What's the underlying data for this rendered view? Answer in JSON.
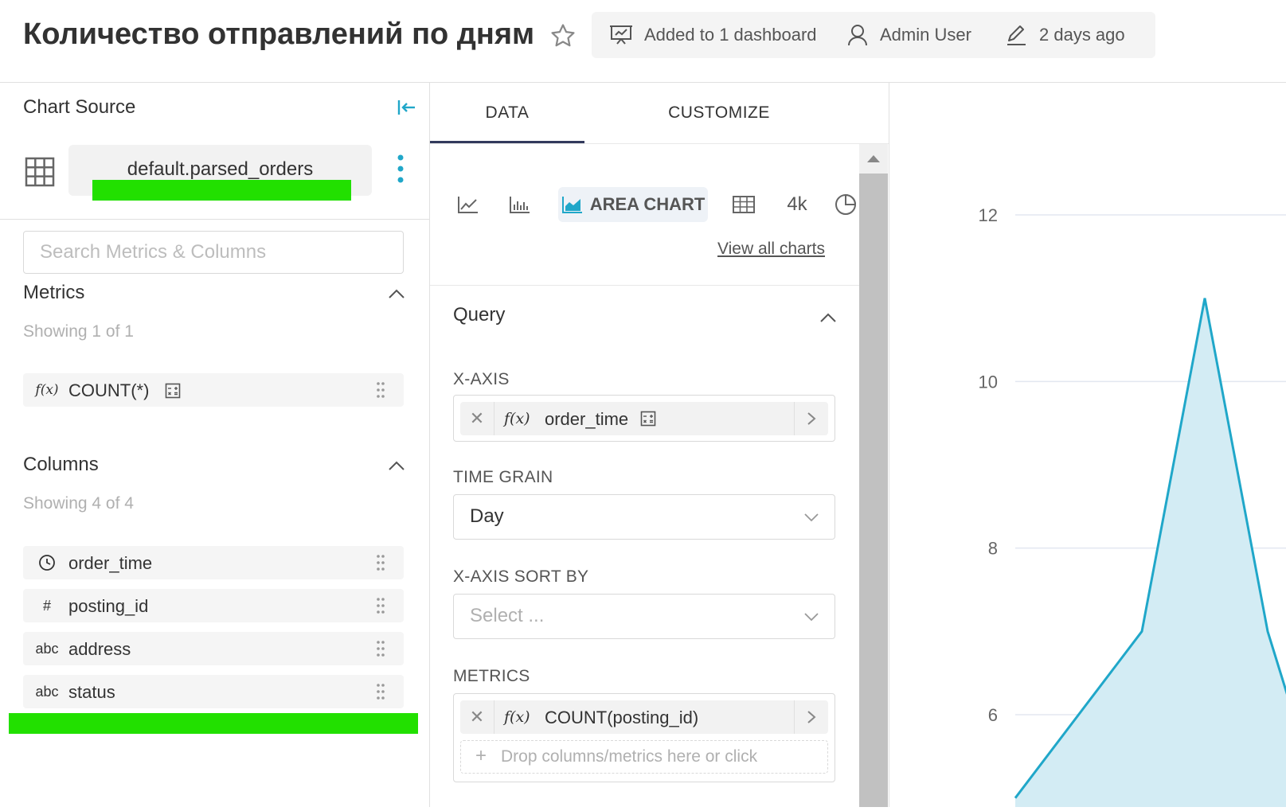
{
  "header": {
    "title": "Количество отправлений по дням",
    "dashboard_info": "Added to 1 dashboard",
    "owner": "Admin User",
    "modified": "2 days ago"
  },
  "source_panel": {
    "title": "Chart Source",
    "dataset": "default.parsed_orders",
    "search_placeholder": "Search Metrics & Columns",
    "metrics": {
      "title": "Metrics",
      "showing": "Showing 1 of 1",
      "items": [
        {
          "type": "f(x)",
          "label": "COUNT(*)"
        }
      ]
    },
    "columns": {
      "title": "Columns",
      "showing": "Showing 4 of 4",
      "items": [
        {
          "type": "clock",
          "label": "order_time"
        },
        {
          "type": "#",
          "label": "posting_id"
        },
        {
          "type": "abc",
          "label": "address"
        },
        {
          "type": "abc",
          "label": "status"
        }
      ]
    }
  },
  "control_panel": {
    "tabs": [
      "DATA",
      "CUSTOMIZE"
    ],
    "active_tab": "DATA",
    "viz_active_label": "AREA CHART",
    "viz_bignum_label": "4k",
    "view_all": "View all charts",
    "query": {
      "title": "Query",
      "x_axis_label": "X-AXIS",
      "x_axis_f": "f(x)",
      "x_axis_value": "order_time",
      "time_grain_label": "TIME GRAIN",
      "time_grain_value": "Day",
      "sort_label": "X-AXIS SORT BY",
      "sort_placeholder": "Select ...",
      "metrics_label": "METRICS",
      "metric_f": "f(x)",
      "metric_value": "COUNT(posting_id)",
      "drop_hint": "Drop columns/metrics here or click"
    }
  },
  "colors": {
    "accent": "#20a7c9",
    "area_fill": "#d3ecf4",
    "highlight": "#22e000",
    "tab_underline": "#323a5c"
  },
  "chart_data": {
    "type": "area",
    "y_ticks": [
      6,
      8,
      10,
      12
    ],
    "yticklabels": [
      "6",
      "8",
      "10",
      "12"
    ],
    "ylim": [
      4.9,
      12.4
    ],
    "x": [
      0,
      1,
      2,
      3,
      4
    ],
    "values": [
      5,
      7,
      11,
      7,
      5.3
    ],
    "grid": true,
    "note_visible": "partial view, x-axis labels not visible"
  }
}
